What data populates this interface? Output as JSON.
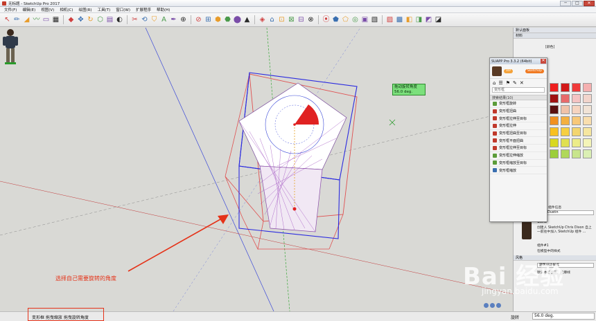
{
  "window": {
    "title": "无标题 - SketchUp Pro 2017",
    "controls": [
      "─",
      "□",
      "✕"
    ]
  },
  "menu": [
    "文件(F)",
    "编辑(E)",
    "视图(V)",
    "相机(C)",
    "绘图(R)",
    "工具(T)",
    "窗口(W)",
    "扩展程序",
    "帮助(H)"
  ],
  "toolbar_icons": [
    "↖",
    "✏",
    "◢",
    "〰",
    "▭",
    "▦",
    "◆",
    "✥",
    "↻",
    "⬡",
    "▤",
    "◐",
    "✂",
    "⟲",
    "⛉",
    "A",
    "✒",
    "⊕",
    "⊘",
    "⊞",
    "⬢",
    "⬣",
    "⬤",
    "▲",
    "◈",
    "⌂",
    "⊡",
    "⊠",
    "⊟",
    "⊗",
    "⦿",
    "⬟",
    "⬠",
    "◎",
    "▣",
    "▧",
    "▨",
    "▩",
    "◧",
    "◨",
    "◩",
    "◪"
  ],
  "viewport": {
    "tooltip_title": "拖动旋转角度",
    "tooltip_value": "56.0 deg.",
    "callout": "选择自己需要旋转的角度",
    "accent": "#e53218"
  },
  "suapp": {
    "title": "SUAPP Pro 3.3.2 (64bit)",
    "close": "✕",
    "badge_left": "VIP",
    "badge_right": "SketchUp",
    "icons": [
      "⌂",
      "☰",
      "⚑",
      "✎",
      "✕"
    ],
    "search_placeholder": "变形框",
    "results_header": "搜索结果(10)",
    "items": [
      {
        "label": "变形框旋转",
        "color": "#5c9c3a"
      },
      {
        "label": "变形框扭曲",
        "color": "#c0392b"
      },
      {
        "label": "变形框拉伸至目标",
        "color": "#c0392b"
      },
      {
        "label": "变形框拉伸",
        "color": "#c0392b"
      },
      {
        "label": "变形框扭曲至目标",
        "color": "#c0392b"
      },
      {
        "label": "变形框平面扭曲",
        "color": "#c0392b"
      },
      {
        "label": "变形框拉伸至目标",
        "color": "#c0392b"
      },
      {
        "label": "变形框拉伸缩放",
        "color": "#5c9c3a"
      },
      {
        "label": "变形框缩放至目标",
        "color": "#5c9c3a"
      },
      {
        "label": "变形框缩放",
        "color": "#3a6fb0"
      }
    ]
  },
  "tray": {
    "title": "默认面板",
    "materials": "材料",
    "mat_name": "[颜色]",
    "component_label": "组件信息",
    "component_input": "Dustin",
    "component_name": "Chris",
    "component_desc": "创建人 SketchUp Chris Dixon 自上一前往中加入 SketchUp 组件 ...",
    "component_count": "组件#1",
    "component_path": "在模型中的样式",
    "styles": "风格",
    "style_name": "建筑设计样式",
    "style_desc": "默认本画面板，轮廓线",
    "swatches": [
      "#ef1f1f",
      "#d21818",
      "#f03a3a",
      "#f5b0b0",
      "#a01212",
      "#e86a6a",
      "#f5c3c3",
      "#f2d5cc",
      "#5a1010",
      "#f0c2a8",
      "#f6d4c0",
      "#f1e3d6",
      "#f19020",
      "#f4b040",
      "#f8c878",
      "#f9deae",
      "#f8c020",
      "#f6cf40",
      "#f3d56e",
      "#f6e6a0",
      "#d8d820",
      "#e0e050",
      "#ecec88",
      "#f4f4b8",
      "#9cce3a",
      "#b0d85a",
      "#c8e58c",
      "#dbefb4"
    ]
  },
  "status": {
    "text": "变形框 拖曳缩放 拖曳旋转角度",
    "measure_label": "旋转",
    "measure_value": "56.0 deg."
  },
  "watermark": {
    "brand": "Bai 经验",
    "sub": "jingyan.baidu.com"
  }
}
